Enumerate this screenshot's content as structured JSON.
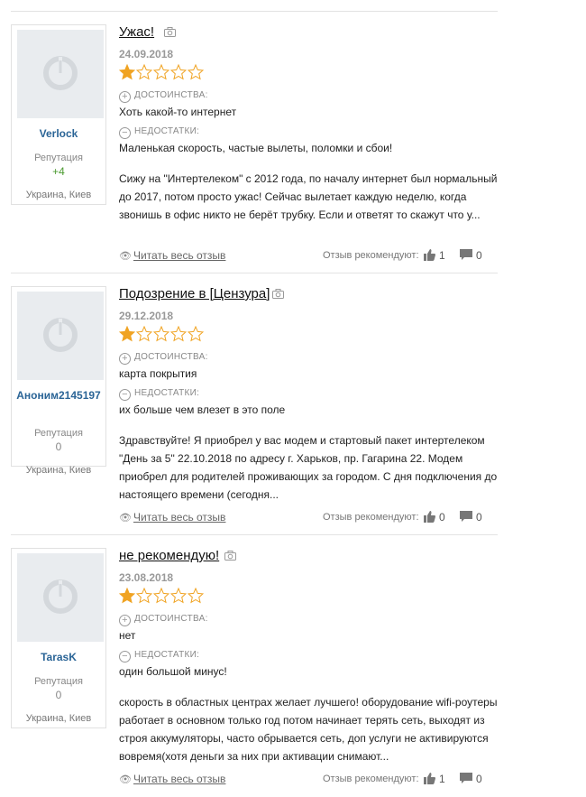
{
  "labels": {
    "pros": "ДОСТОИНСТВА:",
    "cons": "НЕДОСТАТКИ:",
    "reputation": "Репутация",
    "read_full": "Читать весь отзыв",
    "recommend": "Отзыв рекомендуют:"
  },
  "colors": {
    "star": "#f0a322",
    "username": "#2a6496",
    "positive_rep": "#4a9a2e"
  },
  "reviews": [
    {
      "title": "Ужас!",
      "date": "24.09.2018",
      "rating": 1,
      "user": {
        "name": "Verlock",
        "reputation": "+4",
        "location": "Украина, Киев"
      },
      "pros": "Хоть какой-то интернет",
      "cons": "Маленькая скорость, частые вылеты, поломки и сбои!",
      "text": "Сижу на \"Интертелеком\" с 2012 года, по началу интернет был нормальный до 2017, потом просто ужас! Сейчас вылетает каждую неделю, когда звонишь в офис никто не берёт трубку. Если и ответят то скажут что у...",
      "likes": "1",
      "comments": "0"
    },
    {
      "title": "Подозрение в [Цензура]",
      "date": "29.12.2018",
      "rating": 1,
      "user": {
        "name": "Аноним2145197",
        "reputation": "0",
        "location": "Украина, Киев"
      },
      "pros": "карта покрытия",
      "cons": "их больше чем влезет в это поле",
      "text": "Здравствуйте! Я приобрел у вас модем и стартовый пакет интертелеком \"День за 5\" 22.10.2018 по адресу г. Харьков, пр. Гагарина 22. Модем приобрел для родителей проживающих за городом. С дня подключения до настоящего времени (сегодня...",
      "likes": "0",
      "comments": "0"
    },
    {
      "title": "не рекомендую!",
      "date": "23.08.2018",
      "rating": 1,
      "user": {
        "name": "TarasK",
        "reputation": "0",
        "location": "Украина, Киев"
      },
      "pros": "нет",
      "cons": "один большой минус!",
      "text": "скорость в областных центрах желает лучшего! оборудование wifi-роутеры работает в основном только год потом начинает терять сеть, выходят из строя аккумуляторы, часто обрывается сеть, доп услуги не активируются вовремя(хотя деньги за них при активации снимают...",
      "likes": "1",
      "comments": "0"
    }
  ]
}
